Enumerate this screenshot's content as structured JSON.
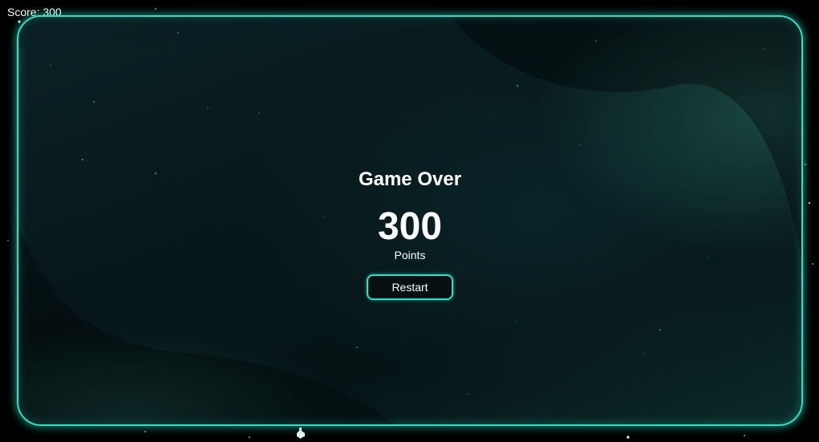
{
  "hud": {
    "score_text": "Score: 300"
  },
  "game_over": {
    "title": "Game Over",
    "score_value": "300",
    "points_label": "Points",
    "restart_label": "Restart"
  },
  "colors": {
    "accent": "#2fe0c4",
    "background": "#000000",
    "panel_dark": "#071618",
    "text": "#ffffff"
  },
  "icons": {
    "ship": "player-ship-icon"
  }
}
